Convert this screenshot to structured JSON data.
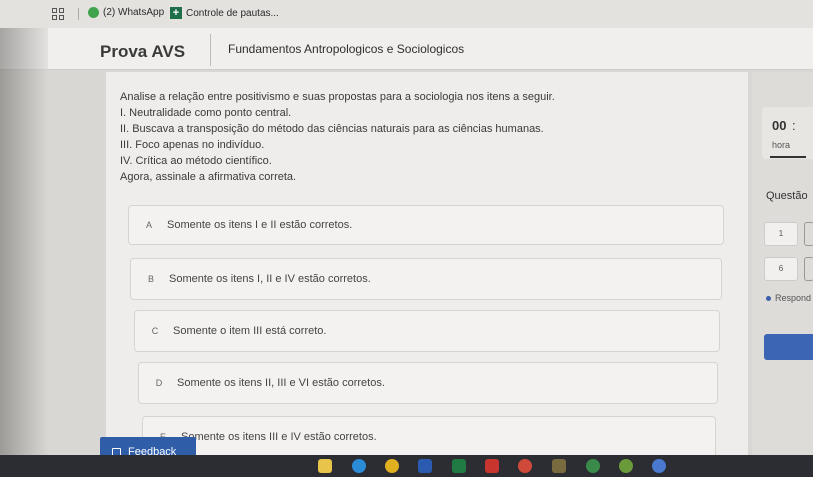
{
  "bookmarks": [
    {
      "label": "(2) WhatsApp",
      "icon": "whatsapp-icon"
    },
    {
      "label": "Controle de pautas...",
      "icon": "plus-icon"
    }
  ],
  "header": {
    "title": "Prova AVS",
    "course": "Fundamentos Antropologicos e Sociologicos"
  },
  "question": {
    "lines": [
      "Analise a relação entre positivismo e suas propostas para a sociologia nos itens a seguir.",
      "I. Neutralidade como ponto central.",
      "II. Buscava a transposição do método das ciências naturais para as ciências humanas.",
      "III. Foco apenas no indivíduo.",
      "IV. Crítica ao método científico.",
      "Agora, assinale a afirmativa correta."
    ]
  },
  "options": [
    {
      "letter": "A",
      "text": "Somente os itens I e II estão corretos."
    },
    {
      "letter": "B",
      "text": "Somente os itens I, II e IV estão corretos."
    },
    {
      "letter": "C",
      "text": "Somente o item III está correto."
    },
    {
      "letter": "D",
      "text": "Somente os itens II, III e VI estão corretos."
    },
    {
      "letter": "E",
      "text": "Somente os itens III e IV estão corretos."
    }
  ],
  "side": {
    "timer_value": "00",
    "timer_colon": ":",
    "timer_label": "hora",
    "questao_label": "Questão",
    "qnums": [
      "1",
      "6"
    ],
    "respond_label": "Respond"
  },
  "feedback": {
    "label": "Feedback"
  },
  "colors": {
    "accent": "#2f5da8",
    "header_bg": "#f0efed"
  }
}
